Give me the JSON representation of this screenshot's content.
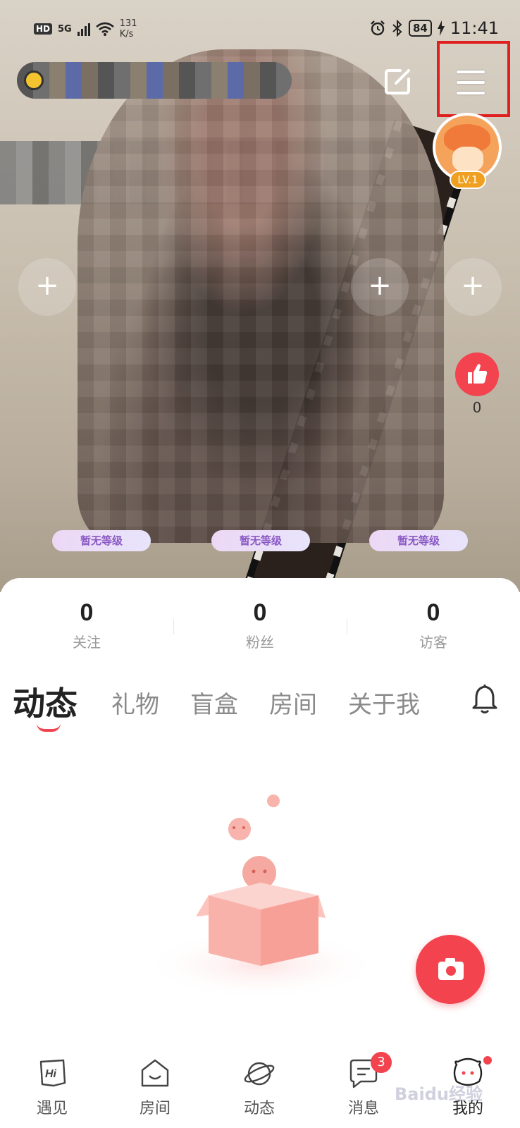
{
  "status_bar": {
    "hd": "HD",
    "network": "5G",
    "net_speed_value": "131",
    "net_speed_unit": "K/s",
    "battery": "84",
    "time": "11:41"
  },
  "profile": {
    "level": "LV.1",
    "like_count": "0",
    "level_pills": [
      "暂无等级",
      "暂无等级",
      "暂无等级"
    ]
  },
  "stats": [
    {
      "value": "0",
      "label": "关注"
    },
    {
      "value": "0",
      "label": "粉丝"
    },
    {
      "value": "0",
      "label": "访客"
    }
  ],
  "tabs": [
    {
      "label": "动态",
      "active": true
    },
    {
      "label": "礼物",
      "active": false
    },
    {
      "label": "盲盒",
      "active": false
    },
    {
      "label": "房间",
      "active": false
    },
    {
      "label": "关于我",
      "active": false
    }
  ],
  "bottom_nav": [
    {
      "label": "遇见",
      "icon": "hi-card-icon"
    },
    {
      "label": "房间",
      "icon": "house-icon"
    },
    {
      "label": "动态",
      "icon": "planet-icon"
    },
    {
      "label": "消息",
      "icon": "chat-icon",
      "badge": "3"
    },
    {
      "label": "我的",
      "icon": "mascot-icon",
      "active": true
    }
  ],
  "watermark": "Baidu经验",
  "colors": {
    "accent": "#f2434f",
    "highlight_box": "#e02020",
    "level_badge": "#f0a020",
    "pill_text": "#8a59c4"
  }
}
